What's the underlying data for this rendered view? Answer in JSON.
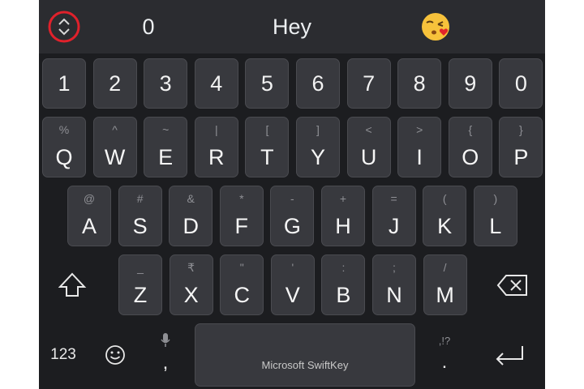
{
  "suggestion_bar": {
    "toggle_icon": "up-down-chevron-icon",
    "items": [
      "0",
      "Hey"
    ],
    "emoji": "😘",
    "accent_color": "#e0212b"
  },
  "number_row": [
    "1",
    "2",
    "3",
    "4",
    "5",
    "6",
    "7",
    "8",
    "9",
    "0"
  ],
  "row1": [
    {
      "sym": "%",
      "ltr": "Q"
    },
    {
      "sym": "^",
      "ltr": "W"
    },
    {
      "sym": "~",
      "ltr": "E"
    },
    {
      "sym": "|",
      "ltr": "R"
    },
    {
      "sym": "[",
      "ltr": "T"
    },
    {
      "sym": "]",
      "ltr": "Y"
    },
    {
      "sym": "<",
      "ltr": "U"
    },
    {
      "sym": ">",
      "ltr": "I"
    },
    {
      "sym": "{",
      "ltr": "O"
    },
    {
      "sym": "}",
      "ltr": "P"
    }
  ],
  "row2": [
    {
      "sym": "@",
      "ltr": "A"
    },
    {
      "sym": "#",
      "ltr": "S"
    },
    {
      "sym": "&",
      "ltr": "D"
    },
    {
      "sym": "*",
      "ltr": "F"
    },
    {
      "sym": "-",
      "ltr": "G"
    },
    {
      "sym": "+",
      "ltr": "H"
    },
    {
      "sym": "=",
      "ltr": "J"
    },
    {
      "sym": "(",
      "ltr": "K"
    },
    {
      "sym": ")",
      "ltr": "L"
    }
  ],
  "row3": [
    {
      "sym": "_",
      "ltr": "Z"
    },
    {
      "sym": "₹",
      "ltr": "X"
    },
    {
      "sym": "\"",
      "ltr": "C"
    },
    {
      "sym": "'",
      "ltr": "V"
    },
    {
      "sym": ":",
      "ltr": "B"
    },
    {
      "sym": ";",
      "ltr": "N"
    },
    {
      "sym": "/",
      "ltr": "M"
    }
  ],
  "bottom_row": {
    "numbers_label": "123",
    "comma_label": ",",
    "space_label": "Microsoft SwiftKey",
    "period_hint": ",!?",
    "period_label": "."
  },
  "icons": {
    "shift": "shift-icon",
    "backspace": "backspace-icon",
    "emoji": "emoji-icon",
    "mic": "microphone-icon",
    "enter": "enter-icon"
  }
}
